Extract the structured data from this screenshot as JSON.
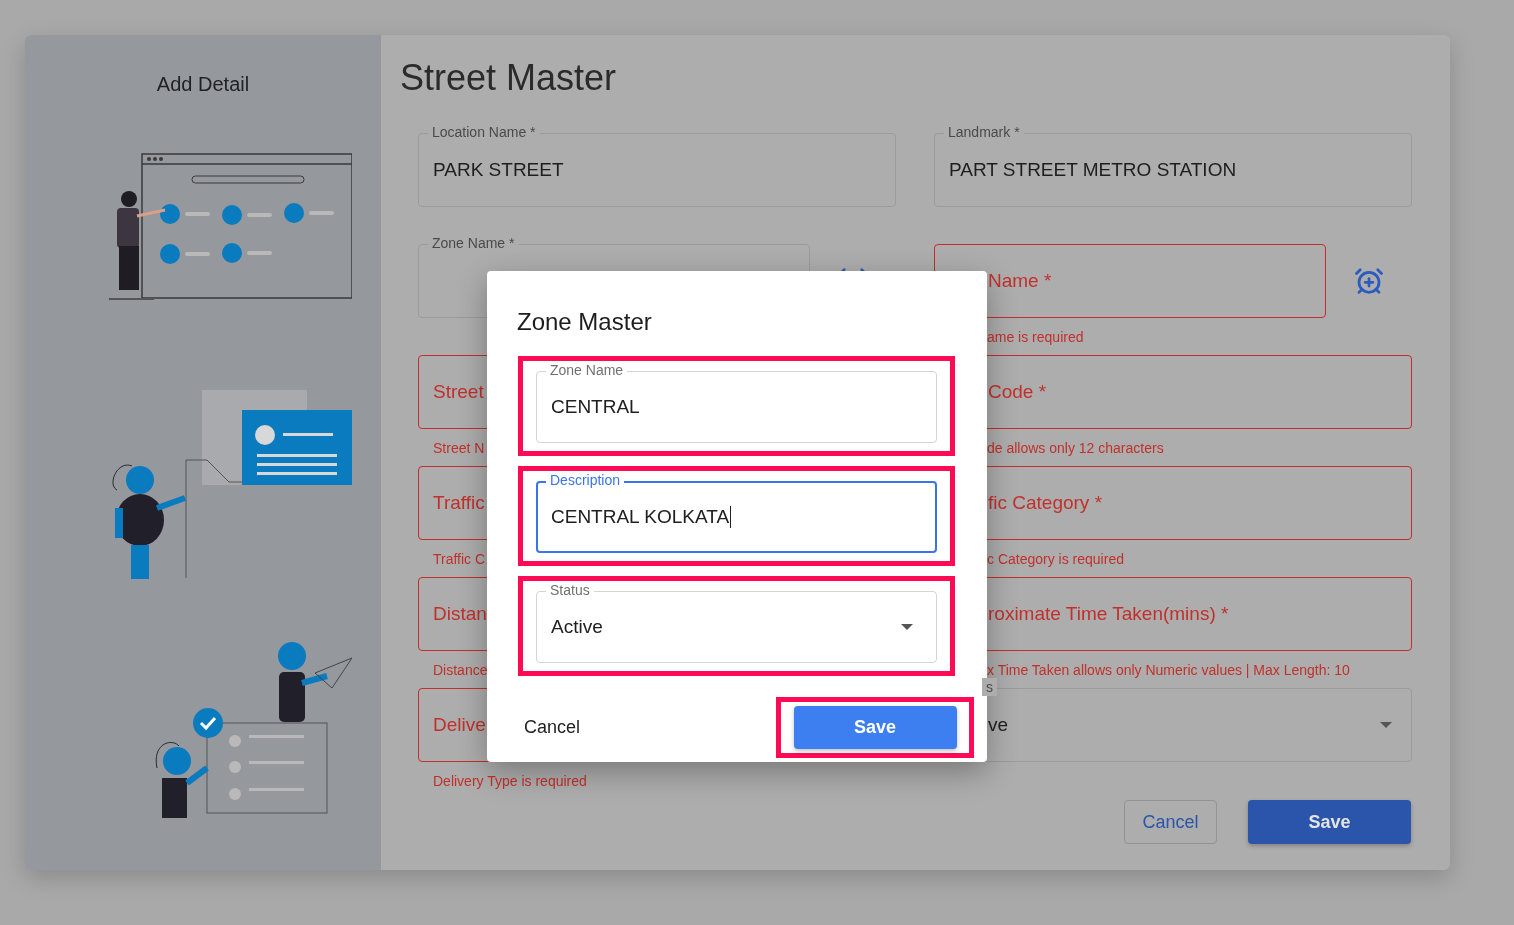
{
  "sidebar": {
    "title": "Add Detail"
  },
  "page": {
    "title": "Street Master"
  },
  "form": {
    "rows": [
      {
        "left": {
          "kind": "text",
          "label": "Location Name *",
          "label_floated": true,
          "value": "PARK STREET",
          "error": false
        },
        "right": {
          "kind": "text",
          "label": "Landmark *",
          "label_floated": true,
          "value": "PART STREET METRO STATION",
          "error": false,
          "covered": false
        }
      },
      {
        "left": {
          "kind": "text",
          "label": "Zone Name *",
          "label_floated": true,
          "error": false,
          "add_button": true
        },
        "right": {
          "kind": "text",
          "label": "Name *",
          "label_floated": false,
          "error": true,
          "covered": true,
          "helper": "ame is required",
          "add_button": true
        }
      },
      {
        "left": {
          "kind": "text",
          "label": "Street",
          "label_floated": false,
          "error": true,
          "helper": "Street N"
        },
        "right": {
          "kind": "text",
          "label": "Code *",
          "label_floated": false,
          "error": true,
          "covered": true,
          "helper": "de allows only 12 characters"
        }
      },
      {
        "left": {
          "kind": "text",
          "label": "Traffic",
          "label_floated": false,
          "error": true,
          "helper": "Traffic C"
        },
        "right": {
          "kind": "text",
          "label": "fic Category *",
          "label_floated": false,
          "error": true,
          "covered": true,
          "helper": "c Category is required"
        }
      },
      {
        "left": {
          "kind": "text",
          "label": "Distan",
          "label_floated": false,
          "error": true,
          "helper": "Distance"
        },
        "right": {
          "kind": "text",
          "label": "roximate Time Taken(mins) *",
          "label_floated": false,
          "error": true,
          "covered": true,
          "helper": "x Time Taken allows only Numeric values | Max Length: 10"
        }
      },
      {
        "left": {
          "kind": "text",
          "label": "Delive",
          "label_floated": false,
          "error": true,
          "helper": "Delivery Type is required"
        },
        "right": {
          "kind": "select",
          "label": "s",
          "label_floated": true,
          "value": "ve",
          "error": false,
          "covered": true
        }
      }
    ],
    "actions": [
      {
        "kind": "outlined",
        "label": "Cancel"
      },
      {
        "kind": "primary",
        "label": "Save"
      }
    ]
  },
  "dialog": {
    "title": "Zone Master",
    "fields": [
      {
        "kind": "text",
        "label": "Zone Name",
        "value": "CENTRAL",
        "focused": false,
        "highlighted": true
      },
      {
        "kind": "text",
        "label": "Description",
        "value": "CENTRAL KOLKATA",
        "focused": true,
        "highlighted": true
      },
      {
        "kind": "select",
        "label": "Status",
        "value": "Active",
        "focused": false,
        "highlighted": true
      }
    ],
    "buttons": [
      {
        "kind": "text",
        "label": "Cancel",
        "highlighted": false
      },
      {
        "kind": "primary",
        "label": "Save",
        "highlighted": true
      }
    ]
  }
}
